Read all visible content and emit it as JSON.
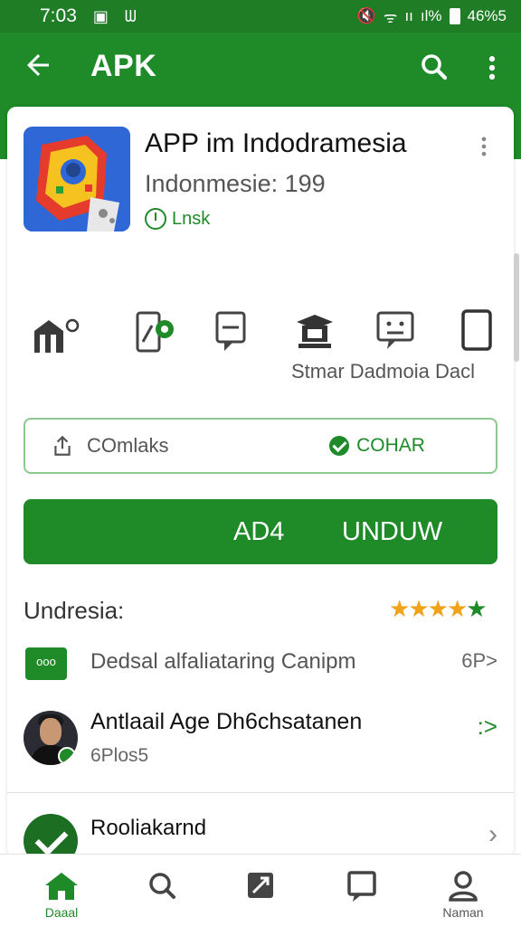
{
  "status_bar": {
    "time": "7:03",
    "battery": "46%5",
    "signal": "ıı",
    "network": "ıl%"
  },
  "app_bar": {
    "title": "APK",
    "colors": {
      "primary": "#1e8a28",
      "statusbar": "#1e7d25"
    },
    "icons": [
      "arrow-back-icon",
      "search-icon",
      "more-vert-icon"
    ]
  },
  "app": {
    "name": "APP im Indodramesia",
    "subtitle": "Indonmesie: 199",
    "badge": "Lnsk"
  },
  "features": {
    "icons": [
      "building-person-icon",
      "phone-share-icon",
      "comment-box-icon",
      "school-hat-icon",
      "emoji-chat-icon",
      "tablet-icon"
    ],
    "label_text": "Stmar Dadmoia Dacl"
  },
  "actions": {
    "share_label": "COmlaks",
    "compare_label": "COHAR",
    "download_label_1": "AD4",
    "download_label_2": "UNDUW"
  },
  "ratings": {
    "section_title": "Undresia:",
    "stars": 5
  },
  "list": {
    "row1": {
      "chip": "ooo",
      "text": "Dedsal alfaliataring Canipm",
      "meta": "6P>"
    },
    "row2": {
      "title": "Antlaail Age Dh6chsatanen",
      "subtitle": "6Plos5",
      "arrow": ":>"
    },
    "row3": {
      "title": "Rooliakarnd",
      "chevron": "›"
    }
  },
  "bottom_nav": [
    {
      "label": "Daaal",
      "icon": "home-icon",
      "active": true
    },
    {
      "label": "",
      "icon": "search-icon",
      "active": false
    },
    {
      "label": "",
      "icon": "apps-icon",
      "active": false
    },
    {
      "label": "",
      "icon": "message-icon",
      "active": false
    },
    {
      "label": "Naman",
      "icon": "profile-icon",
      "active": false
    }
  ]
}
